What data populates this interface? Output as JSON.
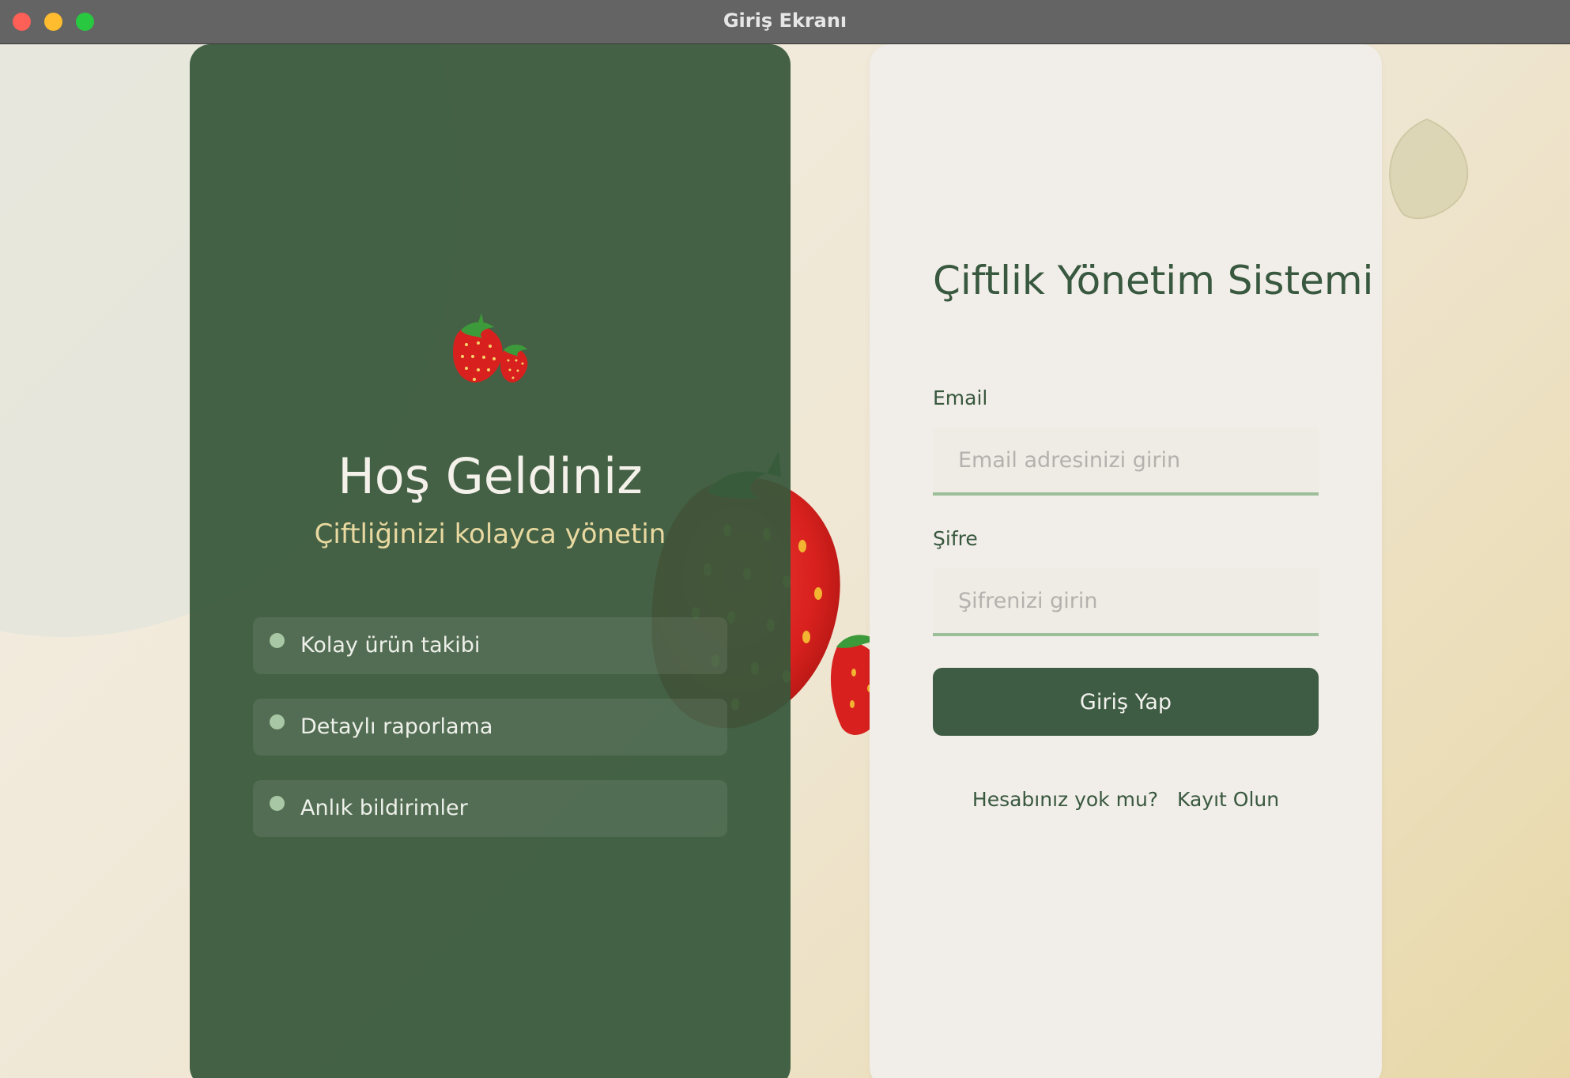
{
  "window": {
    "title": "Giriş Ekranı"
  },
  "welcome": {
    "title": "Hoş Geldiniz",
    "subtitle": "Çiftliğinizi kolayca yönetin",
    "features": [
      {
        "label": "Kolay ürün takibi"
      },
      {
        "label": "Detaylı raporlama"
      },
      {
        "label": "Anlık bildirimler"
      }
    ]
  },
  "login": {
    "app_title": "Çiftlik Yönetim Sistemi",
    "email_label": "Email",
    "email_placeholder": "Email adresinizi girin",
    "email_value": "",
    "password_label": "Şifre",
    "password_placeholder": "Şifrenizi girin",
    "password_value": "",
    "submit_label": "Giriş Yap",
    "no_account_text": "Hesabınız yok mu?",
    "signup_link": "Kayıt Olun"
  },
  "colors": {
    "panel_green": "#38583c",
    "accent_gold": "#e9d9a0",
    "input_underline": "#9cbf9a",
    "button_green": "#3d5c43"
  },
  "icons": {
    "hero": "strawberries-icon",
    "background_decoration": "strawberry-illustration"
  }
}
